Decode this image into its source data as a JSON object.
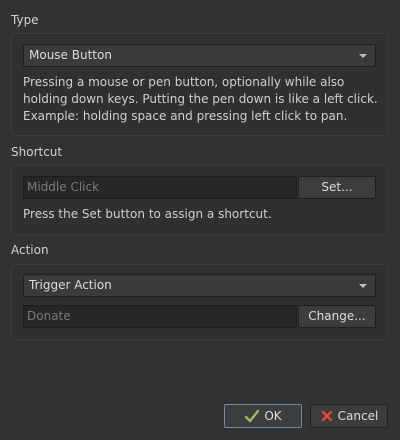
{
  "type_section": {
    "label": "Type",
    "combo_value": "Mouse Button",
    "description": "Pressing a mouse or pen button, optionally while also holding down keys. Putting the pen down is like a left click. Example: holding space and pressing left click to pan."
  },
  "shortcut_section": {
    "label": "Shortcut",
    "field_placeholder": "Middle Click",
    "set_button": "Set...",
    "hint": "Press the Set button to assign a shortcut."
  },
  "action_section": {
    "label": "Action",
    "combo_value": "Trigger Action",
    "field_placeholder": "Donate",
    "change_button": "Change..."
  },
  "dialog_buttons": {
    "ok_label": "OK",
    "cancel_label": "Cancel",
    "ok_icon": "ok-check-icon",
    "cancel_icon": "cancel-x-icon"
  }
}
